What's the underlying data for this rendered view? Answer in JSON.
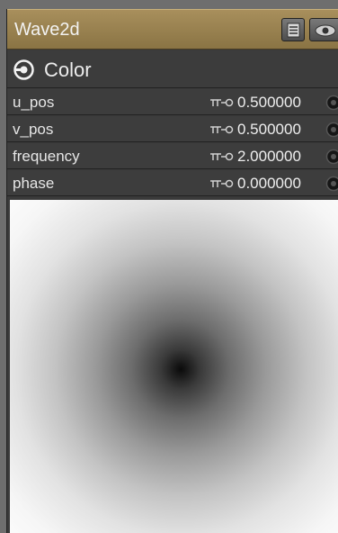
{
  "node": {
    "title": "Wave2d",
    "buttons": {
      "list_icon": "list-icon",
      "eye_icon": "eye-icon"
    },
    "output": {
      "label": "Color",
      "icon": "output-connector-icon"
    },
    "params": [
      {
        "name": "u_pos",
        "value": "0.500000"
      },
      {
        "name": "v_pos",
        "value": "0.500000"
      },
      {
        "name": "frequency",
        "value": "2.000000"
      },
      {
        "name": "phase",
        "value": "0.000000"
      }
    ]
  },
  "colors": {
    "title_bar": "#a88f5c",
    "panel": "#3a3a3a",
    "text": "#e6e6e6"
  }
}
